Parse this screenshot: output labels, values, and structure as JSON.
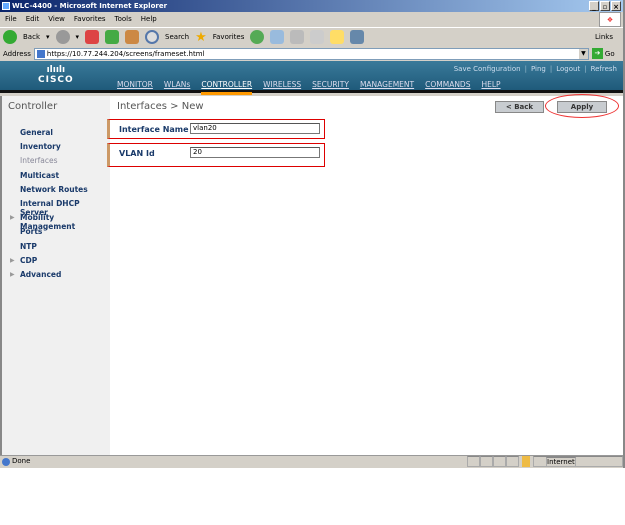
{
  "window": {
    "title": "WLC-4400 - Microsoft Internet Explorer"
  },
  "menu": [
    "File",
    "Edit",
    "View",
    "Favorites",
    "Tools",
    "Help"
  ],
  "toolbar": {
    "back": "Back",
    "search": "Search",
    "favorites": "Favorites",
    "links": "Links"
  },
  "address": {
    "label": "Address",
    "url": "https://10.77.244.204/screens/frameset.html",
    "go": "Go"
  },
  "header": {
    "logo": "CISCO",
    "links": [
      "Save Configuration",
      "Ping",
      "Logout",
      "Refresh"
    ],
    "nav": [
      "MONITOR",
      "WLANs",
      "CONTROLLER",
      "WIRELESS",
      "SECURITY",
      "MANAGEMENT",
      "COMMANDS",
      "HELP"
    ],
    "active": "CONTROLLER"
  },
  "sidebar": {
    "title": "Controller",
    "items": [
      {
        "label": "General"
      },
      {
        "label": "Inventory"
      },
      {
        "label": "Interfaces"
      },
      {
        "label": "Multicast"
      },
      {
        "label": "Network Routes"
      },
      {
        "label": "Internal DHCP Server"
      },
      {
        "label": "Mobility Management"
      },
      {
        "label": "Ports"
      },
      {
        "label": "NTP"
      },
      {
        "label": "CDP"
      },
      {
        "label": "Advanced"
      }
    ]
  },
  "main": {
    "title": "Interfaces > New",
    "back": "< Back",
    "apply": "Apply",
    "fields": {
      "interface_name_label": "Interface Name",
      "interface_name": "vlan20",
      "vlan_id_label": "VLAN Id",
      "vlan_id": "20"
    }
  },
  "status": {
    "text": "Done",
    "zone": "Internet"
  }
}
